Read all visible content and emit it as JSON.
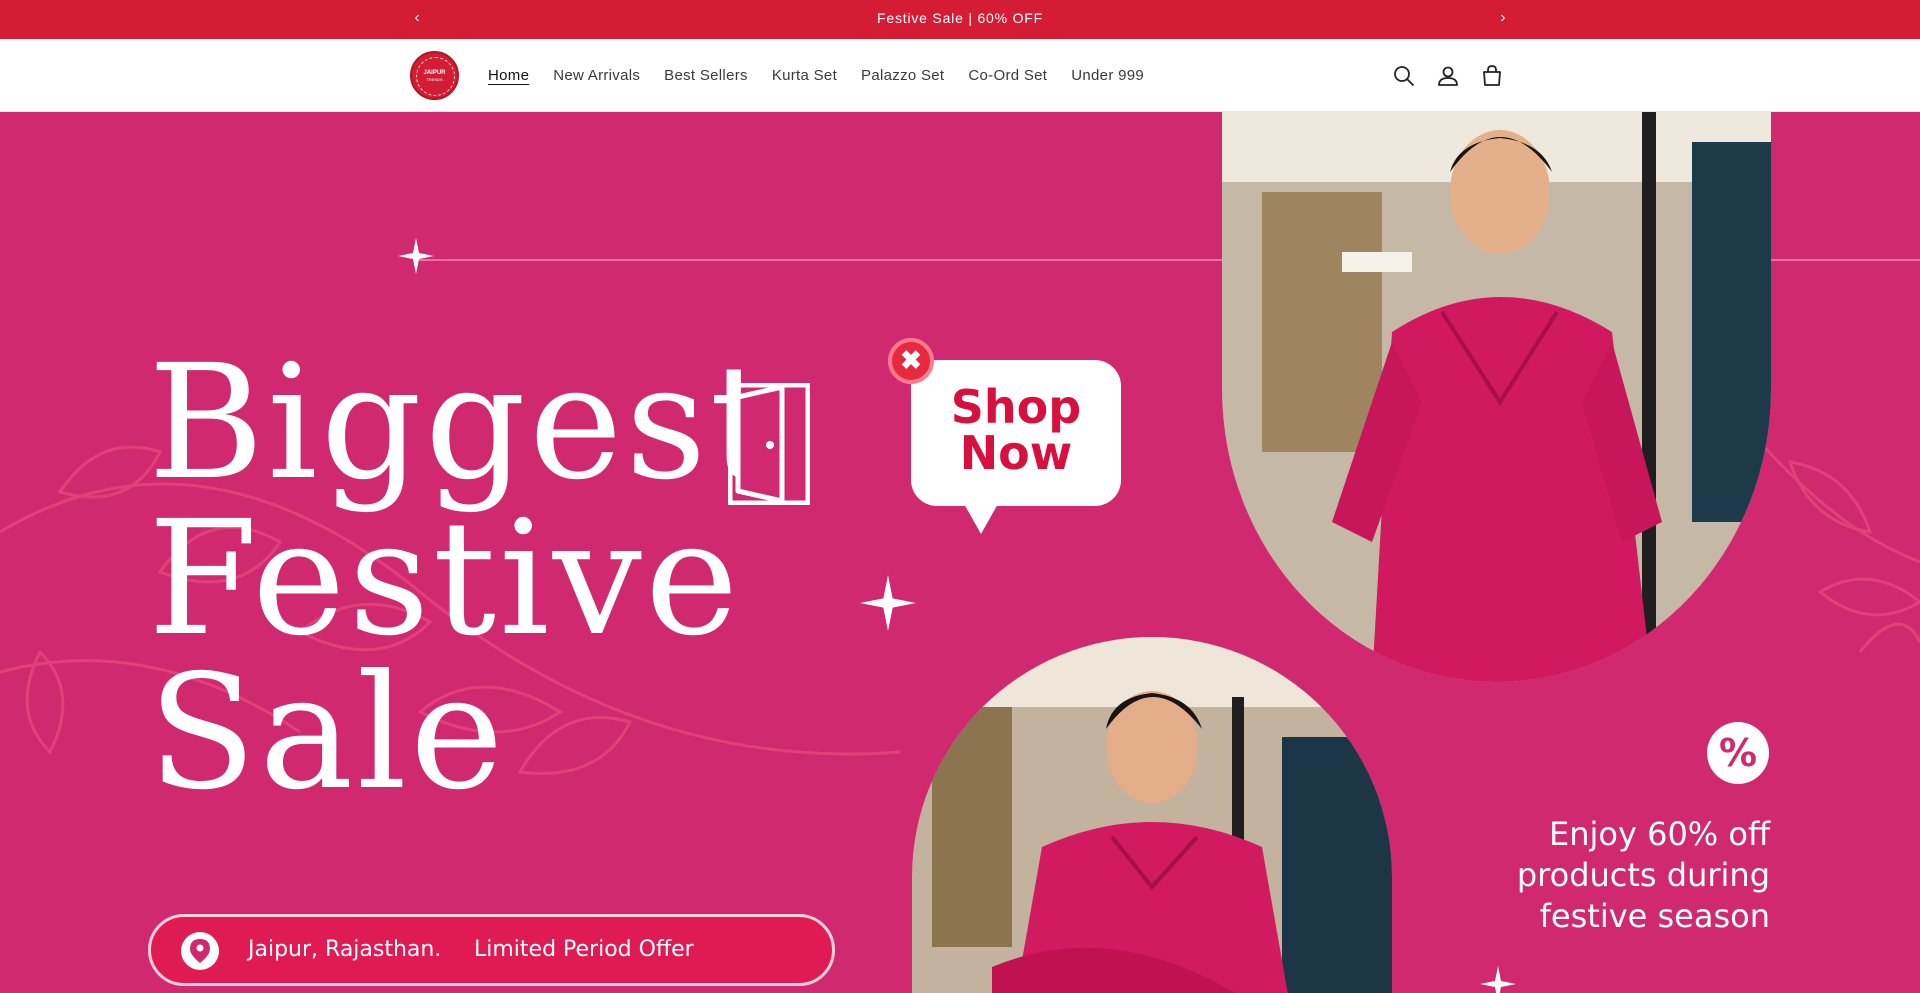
{
  "announcement": {
    "text": "Festive Sale | 60% OFF",
    "prev_icon": "chevron-left-icon",
    "next_icon": "chevron-right-icon",
    "background": "#d41c34"
  },
  "header": {
    "logo": {
      "text": "JAIPUR",
      "subtext": "TRENDS"
    },
    "nav": [
      {
        "label": "Home",
        "active": true
      },
      {
        "label": "New Arrivals"
      },
      {
        "label": "Best Sellers"
      },
      {
        "label": "Kurta Set"
      },
      {
        "label": "Palazzo Set"
      },
      {
        "label": "Co-Ord Set"
      },
      {
        "label": "Under 999"
      }
    ],
    "icons": [
      "search-icon",
      "account-icon",
      "cart-icon"
    ]
  },
  "hero": {
    "background": "#d0296f",
    "headline": [
      "Biggest",
      "Festive",
      "Sale"
    ],
    "cta": "Shop Now",
    "percent_badge": "%",
    "promo_text": [
      "Enjoy 60% off",
      "products during",
      "festive season"
    ],
    "location": "Jaipur, Rajasthan.",
    "offer": "Limited Period Offer"
  }
}
